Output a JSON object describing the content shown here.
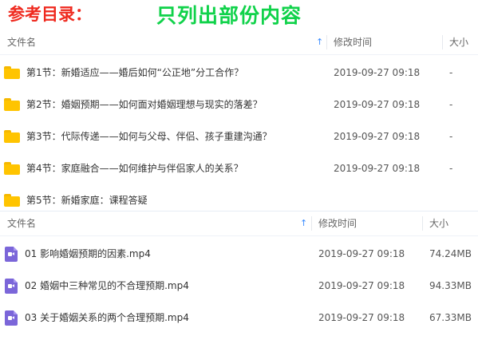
{
  "banner": {
    "title_left": "参考目录：",
    "title_right": "只列出部份内容"
  },
  "folder_pane": {
    "columns": {
      "name": "文件名",
      "modified": "修改时间",
      "size": "大小"
    },
    "rows": [
      {
        "name": "第1节：新婚适应——婚后如何“公正地”分工合作？",
        "modified": "2019-09-27 09:18",
        "size": "-"
      },
      {
        "name": "第2节：婚姻预期——如何面对婚姻理想与现实的落差？",
        "modified": "2019-09-27 09:18",
        "size": "-"
      },
      {
        "name": "第3节：代际传递——如何与父母、伴侣、孩子重建沟通？",
        "modified": "2019-09-27 09:18",
        "size": "-"
      },
      {
        "name": "第4节：家庭融合——如何维护与伴侣家人的关系？",
        "modified": "2019-09-27 09:18",
        "size": "-"
      },
      {
        "name": "第5节：新婚家庭：课程答疑",
        "modified": "",
        "size": ""
      }
    ]
  },
  "file_pane": {
    "columns": {
      "name": "文件名",
      "modified": "修改时间",
      "size": "大小"
    },
    "rows": [
      {
        "name": "01 影响婚姻预期的因素.mp4",
        "modified": "2019-09-27 09:18",
        "size": "74.24MB"
      },
      {
        "name": "02 婚姻中三种常见的不合理预期.mp4",
        "modified": "2019-09-27 09:18",
        "size": "94.33MB"
      },
      {
        "name": "03 关于婚姻关系的两个合理预期.mp4",
        "modified": "2019-09-27 09:18",
        "size": "67.33MB"
      }
    ]
  },
  "colors": {
    "banner_left": "#ef2a1f",
    "banner_right": "#10d24a",
    "folder": "#ffc400",
    "video": "#7b66d9",
    "sort_arrow": "#3b8cff"
  },
  "icons": {
    "folder": "folder-icon",
    "video": "video-file-icon",
    "sort": "sort-ascending-icon"
  }
}
